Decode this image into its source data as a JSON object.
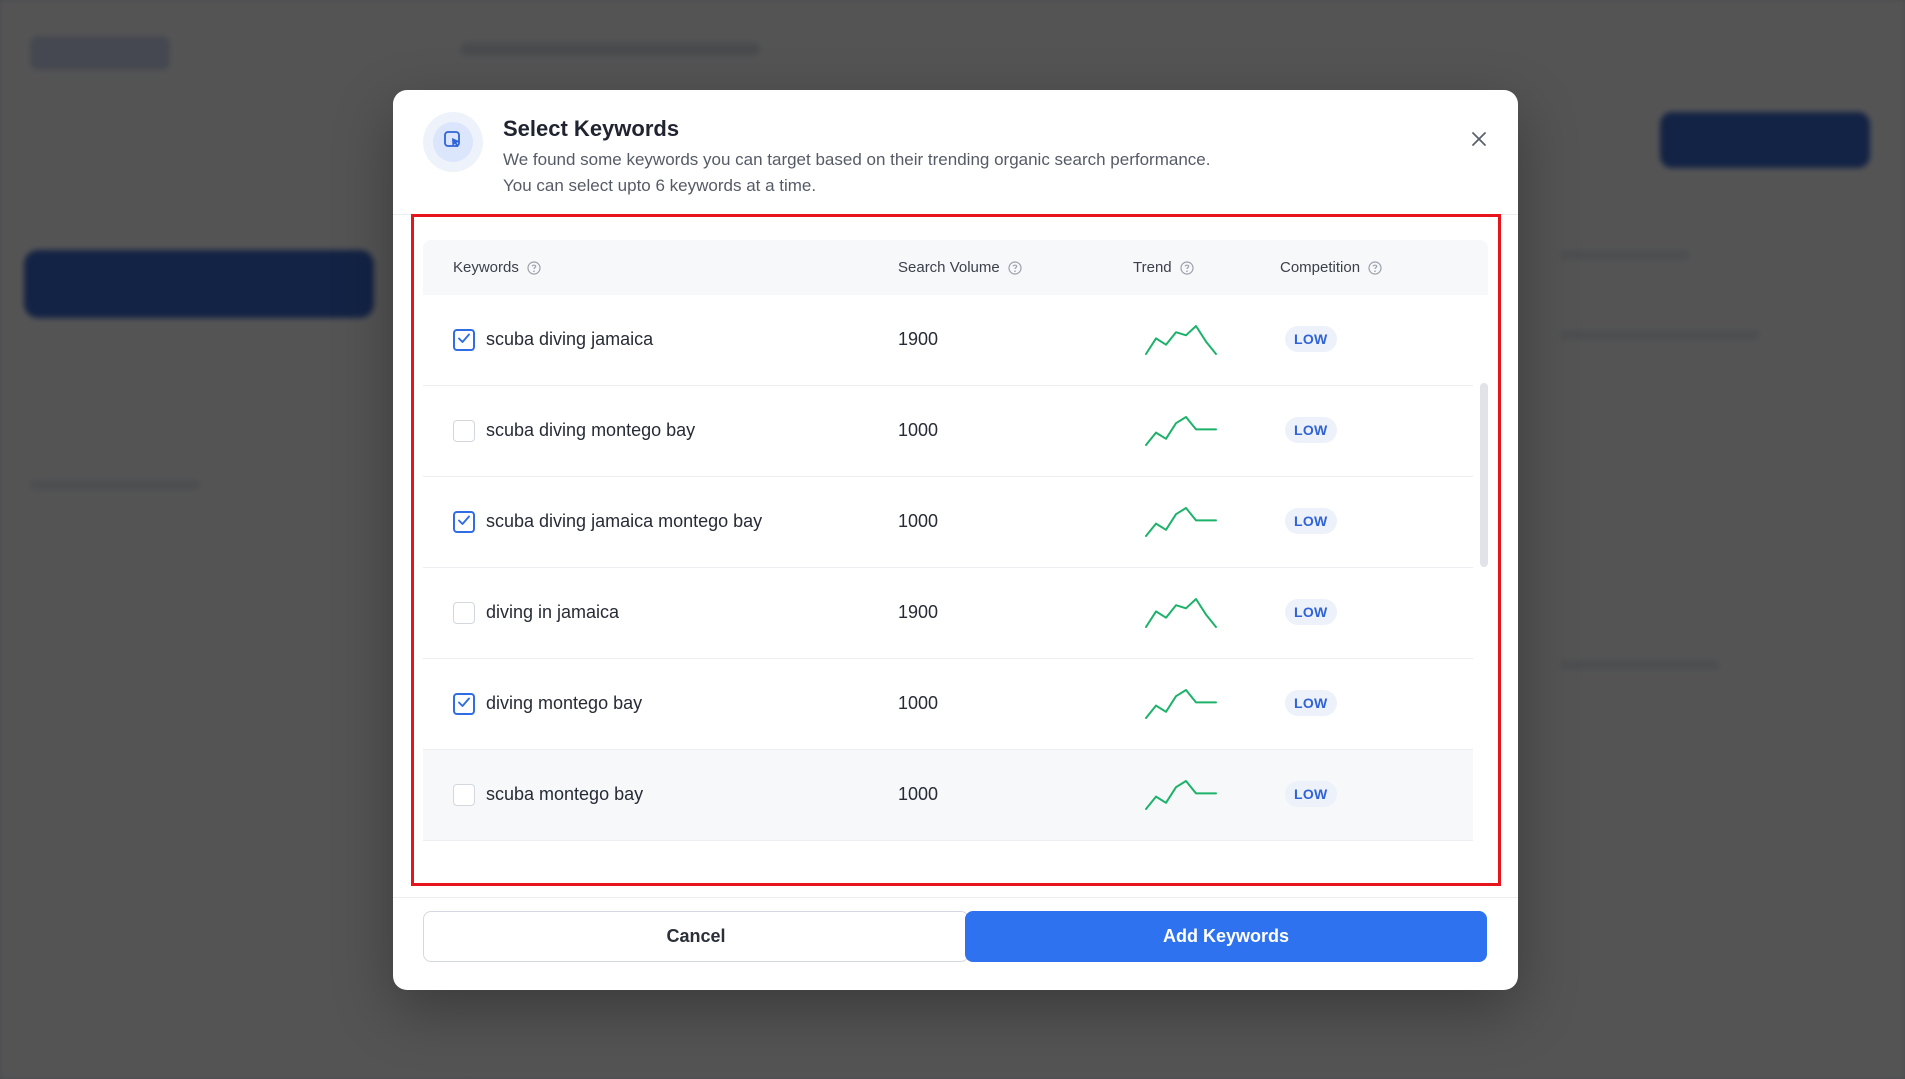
{
  "modal": {
    "title": "Select Keywords",
    "description_line1": "We found some keywords you can target based on their trending organic search performance.",
    "description_line2": "You can select upto 6 keywords at a time."
  },
  "table": {
    "headers": {
      "keywords": "Keywords",
      "search_volume": "Search Volume",
      "trend": "Trend",
      "competition": "Competition"
    },
    "rows": [
      {
        "keyword": "scuba diving jamaica",
        "volume": "1900",
        "competition": "LOW",
        "checked": true,
        "trend": [
          3,
          8,
          6,
          10,
          9,
          12,
          7,
          3
        ]
      },
      {
        "keyword": "scuba diving montego bay",
        "volume": "1000",
        "competition": "LOW",
        "checked": false,
        "trend": [
          2,
          6,
          4,
          9,
          11,
          7,
          7,
          7
        ]
      },
      {
        "keyword": "scuba diving jamaica montego bay",
        "volume": "1000",
        "competition": "LOW",
        "checked": true,
        "trend": [
          2,
          6,
          4,
          9,
          11,
          7,
          7,
          7
        ]
      },
      {
        "keyword": "diving in jamaica",
        "volume": "1900",
        "competition": "LOW",
        "checked": false,
        "trend": [
          3,
          8,
          6,
          10,
          9,
          12,
          7,
          3
        ]
      },
      {
        "keyword": "diving montego bay",
        "volume": "1000",
        "competition": "LOW",
        "checked": true,
        "trend": [
          2,
          6,
          4,
          9,
          11,
          7,
          7,
          7
        ]
      },
      {
        "keyword": "scuba montego bay",
        "volume": "1000",
        "competition": "LOW",
        "checked": false,
        "trend": [
          2,
          6,
          4,
          9,
          11,
          7,
          7,
          7
        ]
      }
    ]
  },
  "footer": {
    "cancel_label": "Cancel",
    "add_label": "Add Keywords"
  },
  "colors": {
    "accent": "#2f72f0",
    "trend_line": "#1db26a",
    "highlight": "#e8141c"
  },
  "icons": {
    "header": "select-cursor-icon",
    "close": "close-icon",
    "help": "help-circle-icon",
    "check": "checkmark-icon"
  }
}
